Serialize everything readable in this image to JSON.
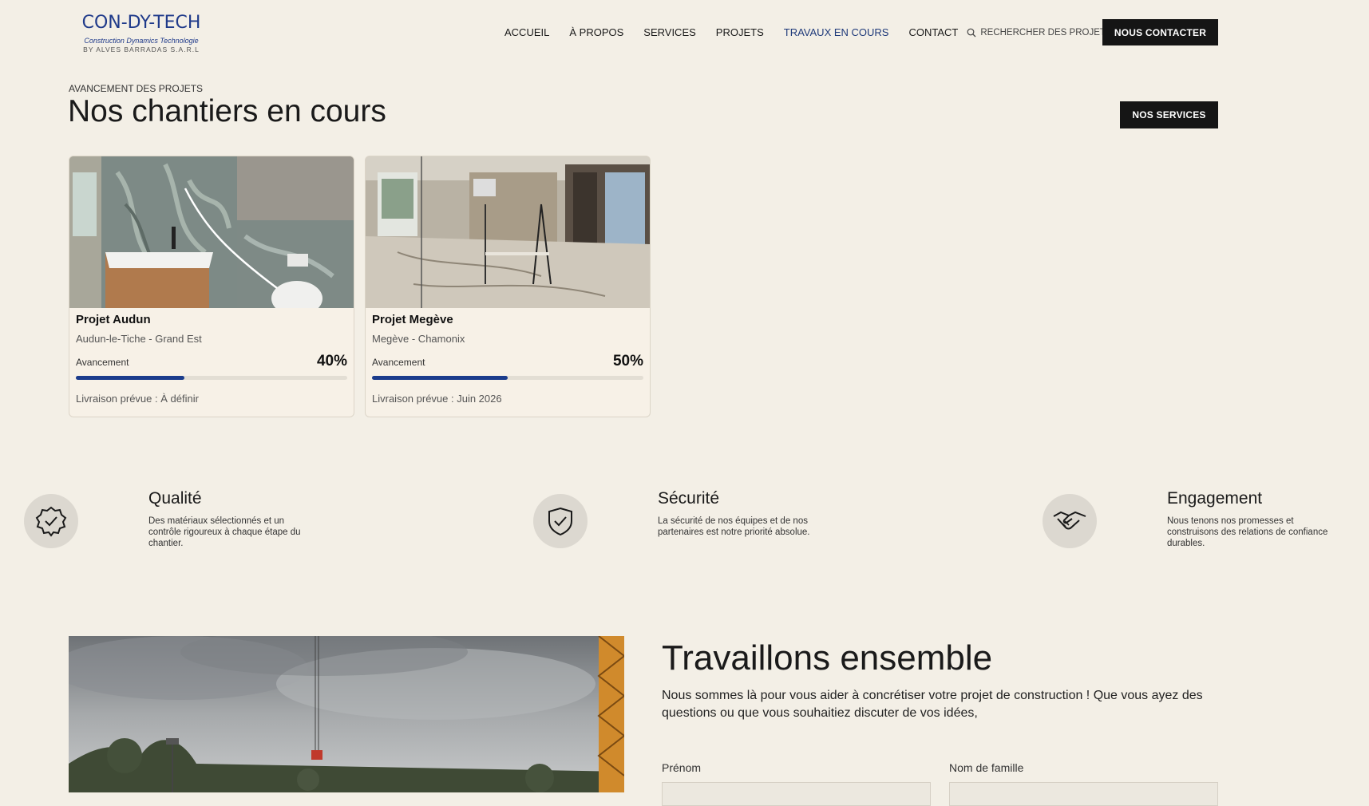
{
  "header": {
    "logo": {
      "main": "CON-DY-TECH",
      "subtitle": "Construction Dynamics Technologie",
      "by": "BY ALVES BARRADAS S.A.R.L"
    },
    "nav": [
      "ACCUEIL",
      "À PROPOS",
      "SERVICES",
      "PROJETS",
      "TRAVAUX EN COURS",
      "CONTACT"
    ],
    "active_nav": "TRAVAUX EN COURS",
    "search_label": "RECHERCHER DES PROJETS",
    "contact_button": "NOUS CONTACTER"
  },
  "section": {
    "eyebrow": "AVANCEMENT DES PROJETS",
    "title": "Nos chantiers en cours",
    "services_button": "NOS SERVICES"
  },
  "projects": [
    {
      "title": "Projet Audun",
      "location": "Audun-le-Tiche - Grand Est",
      "progress_label": "Avancement",
      "progress": "40%",
      "progress_fraction": 0.4,
      "delivery": "Livraison prévue : À définir"
    },
    {
      "title": "Projet Megève",
      "location": "Megève - Chamonix",
      "progress_label": "Avancement",
      "progress": "50%",
      "progress_fraction": 0.5,
      "delivery": "Livraison prévue : Juin 2026"
    }
  ],
  "values": [
    {
      "icon": "badge-check-icon",
      "title": "Qualité",
      "text": "Des matériaux sélectionnés et un contrôle rigoureux à chaque étape du chantier."
    },
    {
      "icon": "shield-check-icon",
      "title": "Sécurité",
      "text": "La sécurité de nos équipes et de nos partenaires est notre priorité absolue."
    },
    {
      "icon": "handshake-icon",
      "title": "Engagement",
      "text": "Nous tenons nos promesses et construisons des relations de confiance durables."
    }
  ],
  "together": {
    "title": "Travaillons ensemble",
    "text": "Nous sommes là pour vous aider à concrétiser votre projet de construction ! Que vous ayez des questions ou que vous souhaitiez discuter de vos idées,",
    "first_name_label": "Prénom",
    "last_name_label": "Nom de famille"
  },
  "colors": {
    "accent": "#1b3c8c",
    "background": "#f3efe6",
    "dark_button": "#151515"
  }
}
